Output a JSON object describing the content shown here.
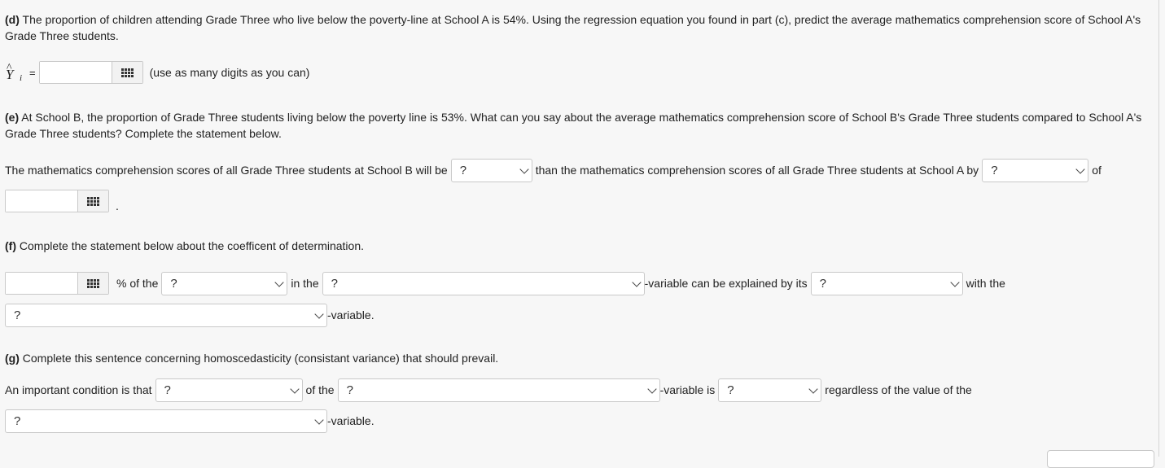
{
  "part_d": {
    "label": "(d)",
    "text": " The proportion of children attending Grade Three who live below the poverty-line at School A is 54%. Using the regression equation you found in part (c), predict the average mathematics comprehension score of School A's Grade Three students.",
    "symbol": "Y",
    "hat": "^",
    "subscript": "i",
    "equals": "=",
    "input_value": "",
    "hint": "(use as many digits as you can)"
  },
  "part_e": {
    "label": "(e)",
    "text": " At School B, the proportion of Grade Three students living below the poverty line is 53%. What can you say about the average mathematics comprehension score of School B's Grade Three students compared to School A's Grade Three students? Complete the statement below.",
    "s1": "The mathematics comprehension scores of all Grade Three students at School B will be",
    "select1": "?",
    "s2": "than the mathematics comprehension scores of all Grade Three students at School A by",
    "select2": "?",
    "s3": "of",
    "input_value": "",
    "period": "."
  },
  "part_f": {
    "label": "(f)",
    "text": " Complete the statement below about the coefficent of determination.",
    "input_value": "",
    "s1": "% of the",
    "select1": "?",
    "s2": "in the",
    "select2": "?",
    "s3": "-variable can be explained by its",
    "select3": "?",
    "s4": "with the",
    "select4": "?",
    "s5": "-variable."
  },
  "part_g": {
    "label": "(g)",
    "text": " Complete this sentence concerning homoscedasticity (consistant variance) that should prevail.",
    "s1": "An important condition is that",
    "select1": "?",
    "s2": "of the",
    "select2": "?",
    "s3": "-variable is",
    "select3": "?",
    "s4": "regardless of the value of the",
    "select4": "?",
    "s5": "-variable."
  },
  "icons": {
    "keypad": "grid-keypad-icon",
    "dropdown": "chevron-down-icon"
  }
}
